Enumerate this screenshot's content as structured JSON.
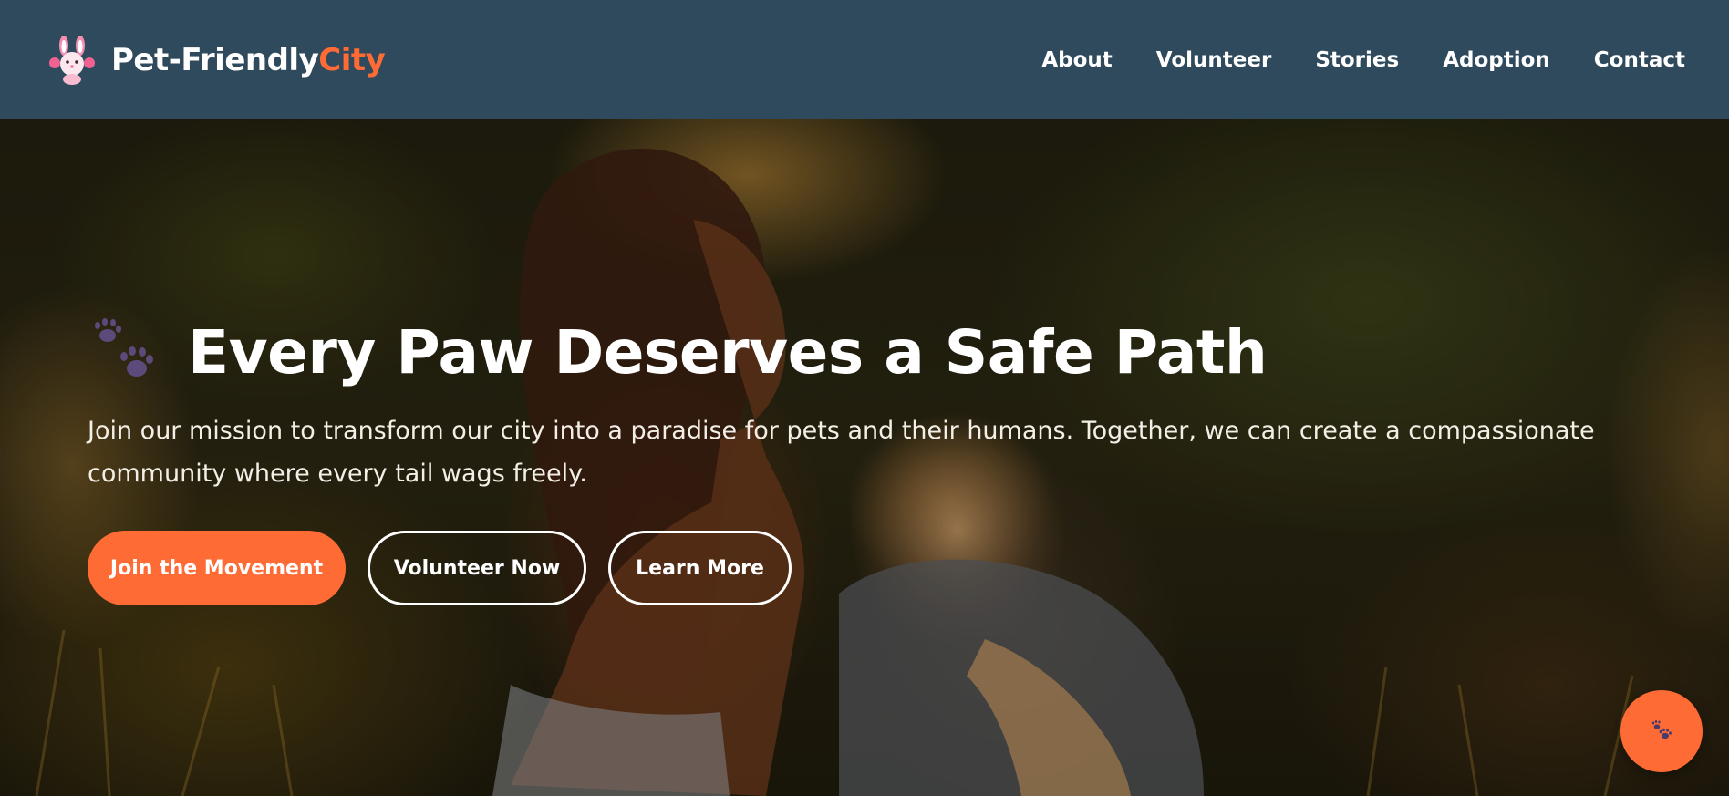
{
  "brand": {
    "name_main": "Pet-Friendly",
    "name_accent": "City",
    "logo_icon": "bunny-paw-logo-icon",
    "accent_color": "#ff6b35"
  },
  "nav": {
    "items": [
      {
        "label": "About"
      },
      {
        "label": "Volunteer"
      },
      {
        "label": "Stories"
      },
      {
        "label": "Adoption"
      },
      {
        "label": "Contact"
      }
    ]
  },
  "hero": {
    "icon": "paw-prints-icon",
    "headline": "Every Paw Deserves a Safe Path",
    "subtitle": "Join our mission to transform our city into a paradise for pets and their humans. Together, we can create a compassionate community where every tail wags freely.",
    "buttons": {
      "primary": "Join the Movement",
      "volunteer": "Volunteer Now",
      "learn": "Learn More"
    }
  },
  "fab": {
    "icon": "paw-icon"
  },
  "colors": {
    "header_bg": "#2f4a5c",
    "accent": "#ff6b35",
    "text": "#ffffff"
  }
}
